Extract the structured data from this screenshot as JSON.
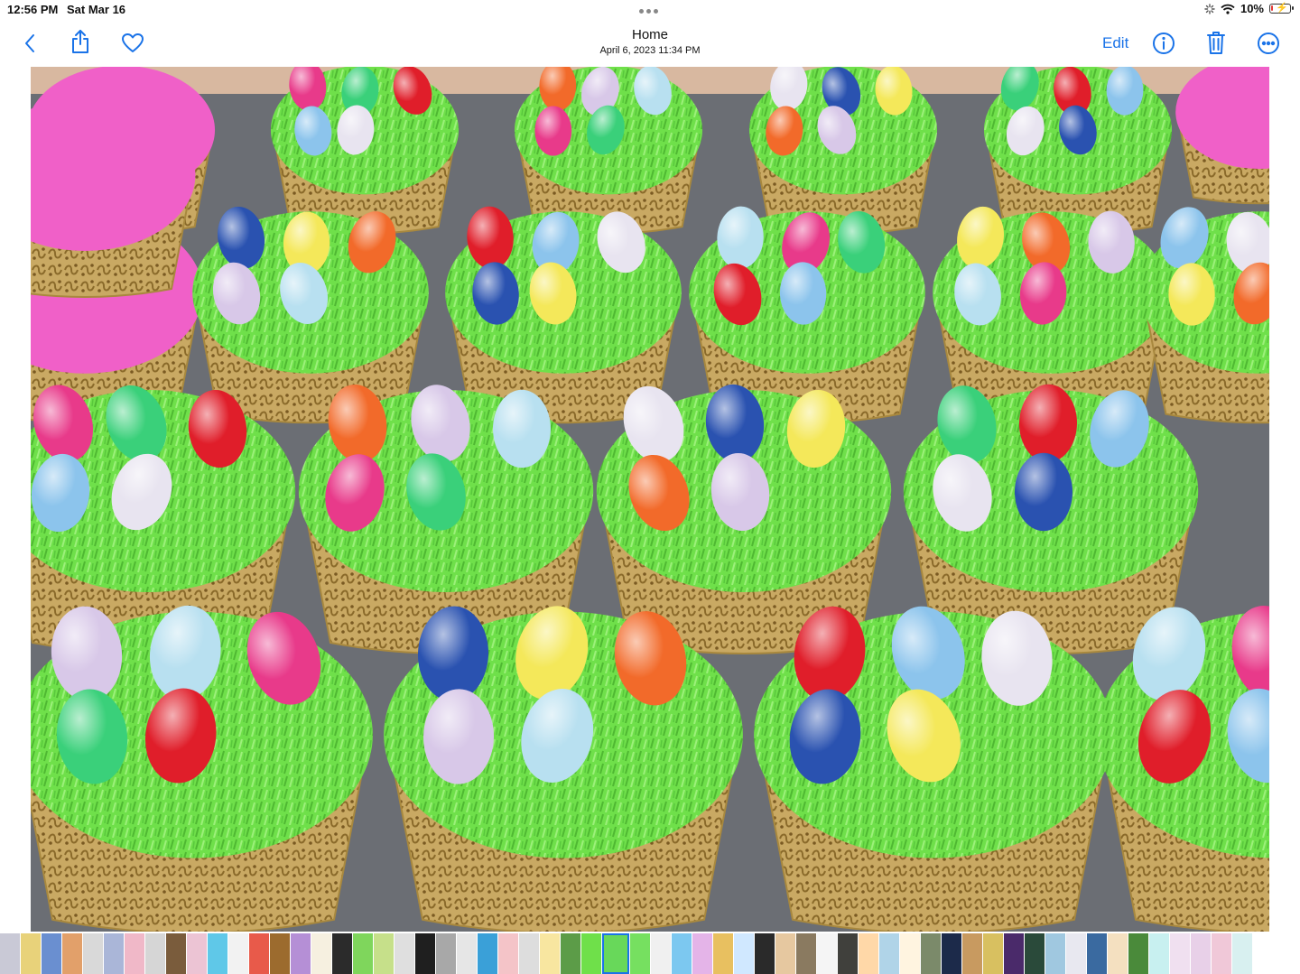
{
  "status_bar": {
    "time": "12:56 PM",
    "date": "Sat Mar 16",
    "battery": "10%",
    "battery_level": 0.1,
    "icons": [
      "loading-icon",
      "wifi-icon",
      "battery-charging-icon"
    ]
  },
  "header": {
    "title": "Home",
    "subtitle": "April 6, 2023  11:34 PM",
    "edit_label": "Edit",
    "icons": [
      "back-chevron-icon",
      "share-icon",
      "heart-icon",
      "info-icon",
      "trash-icon",
      "more-icon"
    ]
  },
  "colors": {
    "accent": "#1a73e8",
    "grass": "#6fe04a",
    "liner": "#c8a860",
    "tray": "#6f7176"
  },
  "photo": {
    "subject": "easter-egg-cupcakes-photo"
  },
  "thumbnails": {
    "count": 60,
    "current_index": 29,
    "palette": [
      "#c9c9d6",
      "#e8d27a",
      "#6a8fd0",
      "#e2a06a",
      "#d9d9d9",
      "#aab6d8",
      "#f0b8c8",
      "#d6d6d6",
      "#7a5c3c",
      "#ecc4d4",
      "#5fc8e8",
      "#f2f2f2",
      "#e85a4a",
      "#9c6b2e",
      "#b58fd6",
      "#f6f0e0",
      "#2b2b2b",
      "#7fd65c",
      "#c6e08a",
      "#dfdfdf",
      "#1f1f1f",
      "#a8a8a8",
      "#e6e6e6",
      "#3aa0d8",
      "#f4c4c8",
      "#ddd",
      "#f8e6a0",
      "#5c9c48",
      "#6fe04a",
      "#68d85a",
      "#76e060",
      "#f0f0f0",
      "#7cc8f0",
      "#e4b4e8",
      "#e8c060",
      "#d0e8ff",
      "#2a2a2a",
      "#e6c8a0",
      "#8a7a60",
      "#f5f5f5",
      "#40403c",
      "#ffd8a8",
      "#b0d4e8",
      "#fff4e0",
      "#7b8a6a",
      "#1c2a4a",
      "#c89a60",
      "#d8c060",
      "#4a2a6a",
      "#2a4a3a",
      "#a0c8e0",
      "#e8e8f0",
      "#3a6aa0",
      "#f4e0c0",
      "#4a8a3a",
      "#c8f0f0",
      "#f0e0f0",
      "#e8d0e8",
      "#f0c8d8",
      "#d8f0f0"
    ]
  }
}
